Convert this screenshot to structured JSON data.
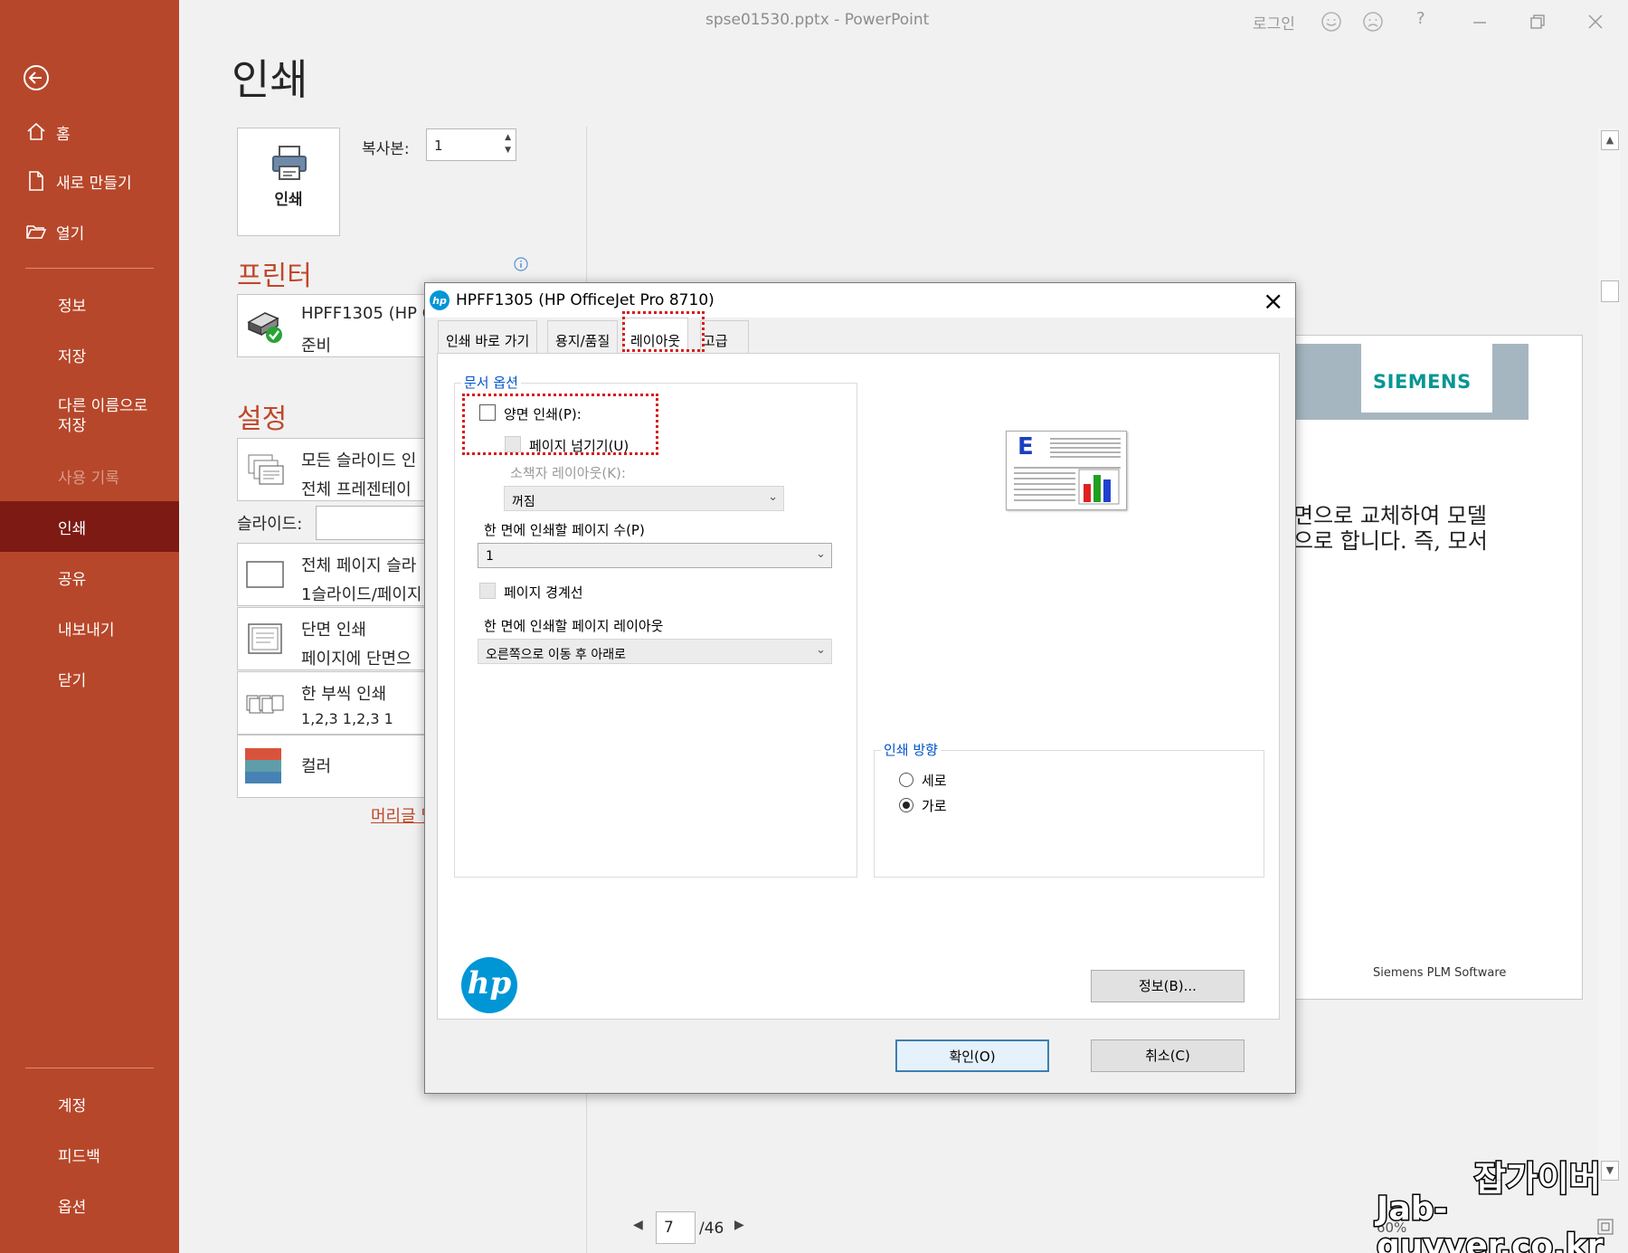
{
  "window": {
    "title": "spse01530.pptx - PowerPoint",
    "sign_in": "로그인",
    "controls": [
      "smile-icon",
      "frown-icon",
      "help-icon",
      "minimize-icon",
      "restore-icon",
      "close-icon"
    ],
    "help": "?"
  },
  "nav": {
    "back_icon": "back-arrow-icon",
    "items": [
      {
        "label": "홈",
        "icon": "home-icon"
      },
      {
        "label": "새로 만들기",
        "icon": "new-document-icon"
      },
      {
        "label": "열기",
        "icon": "open-folder-icon"
      },
      {
        "label": "정보"
      },
      {
        "label": "저장"
      },
      {
        "label": "다른 이름으로\n저장"
      },
      {
        "label": "사용 기록"
      },
      {
        "label": "인쇄"
      },
      {
        "label": "공유"
      },
      {
        "label": "내보내기"
      },
      {
        "label": "닫기"
      },
      {
        "label": "계정"
      },
      {
        "label": "피드백"
      },
      {
        "label": "옵션"
      }
    ],
    "active": "인쇄",
    "disabled": "사용 기록",
    "accent_color": "#b7472a",
    "active_color": "#7d1a14"
  },
  "print": {
    "title": "인쇄",
    "print_button_label": "인쇄",
    "copies_label": "복사본:",
    "copies_value": "1",
    "printer_heading": "프린터",
    "printer_name": "HPFF1305 (HP Of",
    "printer_status": "준비",
    "settings_heading": "설정",
    "settings": [
      {
        "line1": "모든 슬라이드 인",
        "line2": "전체 프레젠테이"
      },
      {
        "line1": "전체 페이지 슬라",
        "line2": "1슬라이드/페이지"
      },
      {
        "line1": "단면 인쇄",
        "line2": "페이지에 단면으"
      },
      {
        "line1": "한 부씩 인쇄",
        "line2": "1,2,3     1,2,3     1"
      },
      {
        "line1": "컬러",
        "line2": ""
      }
    ],
    "slides_label": "슬라이드:",
    "header_footer_link": "머리글 및"
  },
  "preview": {
    "logo_text": "SIEMENS",
    "text_line1": "면으로 교체하여 모델",
    "text_line2": "으로 합니다. 즉, 모서",
    "footer": "Siemens PLM Software",
    "current_page": "7",
    "total_pages": "/46",
    "zoom": "60%"
  },
  "dialog": {
    "title": "HPFF1305 (HP OfficeJet Pro 8710)",
    "tabs": [
      "인쇄 바로 가기",
      "용지/품질",
      "레이아웃",
      "고급"
    ],
    "selected_tab": "레이아웃",
    "doc_options_title": "문서 옵션",
    "duplex_label": "양면 인쇄(P):",
    "duplex_checked": false,
    "flip_label": "페이지 넘기기(U)",
    "booklet_label": "소책자 레이아웃(K):",
    "booklet_value": "꺼짐",
    "pages_per_sheet_label": "한 면에 인쇄할 페이지 수(P)",
    "pages_per_sheet_value": "1",
    "page_borders_label": "페이지 경계선",
    "page_order_label": "한 면에 인쇄할 페이지 레이아웃",
    "page_order_value": "오른쪽으로 이동 후 아래로",
    "orientation_title": "인쇄 방향",
    "portrait_label": "세로",
    "landscape_label": "가로",
    "orientation": "가로",
    "info_button": "정보(B)...",
    "ok_button": "확인(O)",
    "cancel_button": "취소(C)",
    "preview_letter": "E",
    "logo_text": "hp"
  },
  "watermark": {
    "line1": "잡가이버",
    "line2": "Jab-guyver.co.kr"
  }
}
